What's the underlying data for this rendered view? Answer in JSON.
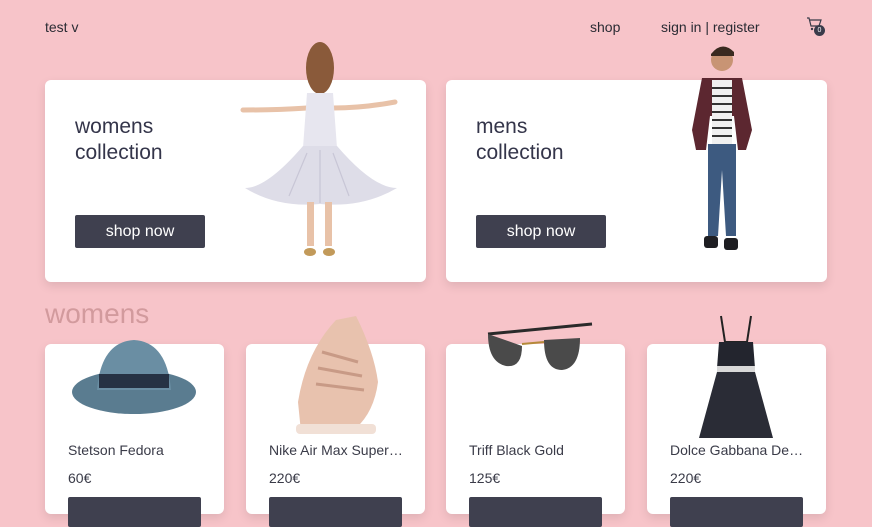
{
  "header": {
    "brand": "test v",
    "nav_shop": "shop",
    "nav_auth": "sign in | register",
    "cart_count": "0"
  },
  "heroes": [
    {
      "title_line1": "womens",
      "title_line2": "collection",
      "button": "shop now"
    },
    {
      "title_line1": "mens",
      "title_line2": "collection",
      "button": "shop now"
    }
  ],
  "section_title": "womens",
  "products": [
    {
      "name": "Stetson Fedora",
      "price": "60€"
    },
    {
      "name": "Nike Air Max Super…",
      "price": "220€"
    },
    {
      "name": "Triff Black Gold",
      "price": "125€"
    },
    {
      "name": "Dolce Gabbana De…",
      "price": "220€"
    }
  ],
  "colors": {
    "background": "#f7c4c9",
    "button": "#3f404f",
    "section_title": "#d29a9d"
  }
}
